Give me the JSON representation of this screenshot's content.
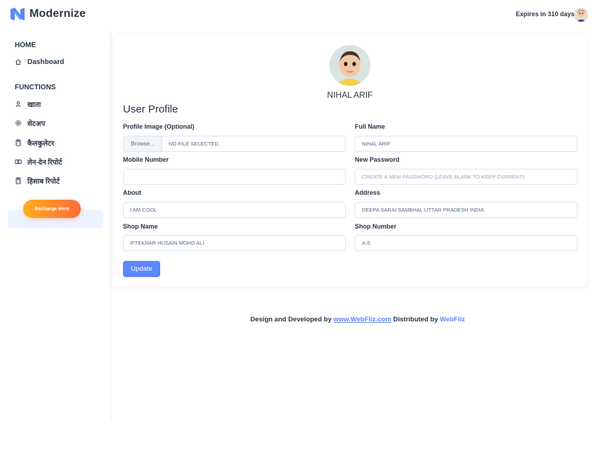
{
  "app": {
    "name": "Modernize",
    "expires_text": "Expires in 310 days"
  },
  "sidebar": {
    "home_caption": "HOME",
    "dashboard_label": "Dashboard",
    "functions_caption": "FUNCTIONS",
    "items": [
      {
        "label": "खाता",
        "icon": "user-icon"
      },
      {
        "label": "सेटअप",
        "icon": "settings-icon"
      },
      {
        "label": "कैलकुलेटर",
        "icon": "calculator-icon"
      },
      {
        "label": "लेन-देन रिपोर्ट",
        "icon": "cash-icon"
      },
      {
        "label": "हिसाब रिपोर्ट",
        "icon": "calculator-icon"
      }
    ],
    "recharge_label": "Recharge Here"
  },
  "profile": {
    "display_name": "NIHAL ARIF",
    "section_title": "User Profile",
    "image_label": "Profile Image (Optional)",
    "browse_label": "Browse...",
    "file_status": "No file selected.",
    "full_name_label": "Full Name",
    "full_name_value": "NIHAL ARIF",
    "mobile_label": "Mobile Number",
    "mobile_value": "",
    "password_label": "New Password",
    "password_placeholder": "Create a new password (leave blank to keep current)",
    "about_label": "About",
    "about_value": "I am cool",
    "address_label": "Address",
    "address_value": "DEEPA SARAI SAMBHAL UTTAR PRADESH INDIA",
    "shop_name_label": "Shop Name",
    "shop_name_value": "IFTEKHAR HUSAIN MOHD ALI",
    "shop_number_label": "Shop Number",
    "shop_number_value": "A-5",
    "update_label": "Update"
  },
  "footer": {
    "prefix": "Design and Developed by",
    "link1": "www.WebFliz.com",
    "middle": "Distributed by",
    "link2": "WebFliz"
  },
  "colors": {
    "primary": "#5d87ff",
    "text": "#2a3547",
    "recharge_gradient_start": "#ffae1f",
    "recharge_gradient_end": "#ff6b3a"
  }
}
